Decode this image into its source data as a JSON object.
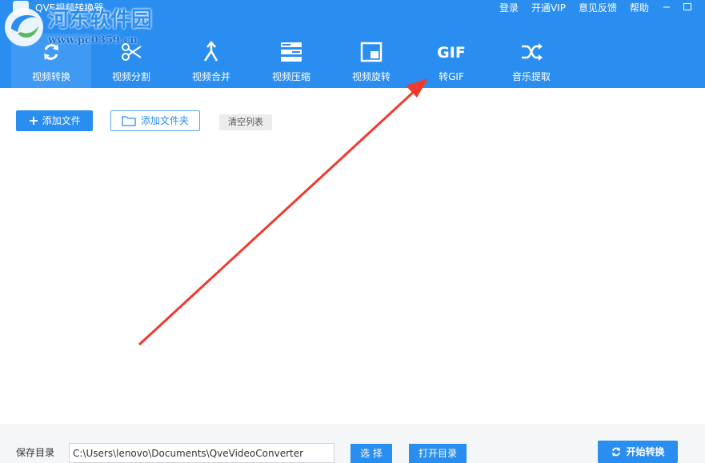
{
  "window": {
    "title": "QVE视频转换器",
    "links": [
      "登录",
      "开通VIP",
      "意见反馈",
      "帮助"
    ],
    "minimize_glyph": "−"
  },
  "watermark": {
    "line1": "河东软件园",
    "line2": "www.pc0359.cn"
  },
  "tabs": [
    {
      "label": "视频转换",
      "icon": "refresh-icon",
      "active": true
    },
    {
      "label": "视频分割",
      "icon": "scissors-icon",
      "active": false
    },
    {
      "label": "视频合并",
      "icon": "merge-icon",
      "active": false
    },
    {
      "label": "视频压缩",
      "icon": "compress-icon",
      "active": false
    },
    {
      "label": "视频旋转",
      "icon": "rotate-icon",
      "active": false
    },
    {
      "label": "转GIF",
      "icon": "gif-icon",
      "active": false,
      "icon_text": "GIF"
    },
    {
      "label": "音乐提取",
      "icon": "shuffle-icon",
      "active": false
    }
  ],
  "toolbar": {
    "add_file": "添加文件",
    "add_folder": "添加文件夹",
    "clear_list": "清空列表"
  },
  "footer": {
    "save_label": "保存目录",
    "path_value": "C:\\Users\\lenovo\\Documents\\QveVideoConverter",
    "choose": "选 择",
    "open_dir": "打开目录",
    "start": "开始转换"
  },
  "colors": {
    "primary": "#2a8df0",
    "active_tab": "#3f9af3",
    "annotation_arrow": "#f03a2e"
  }
}
